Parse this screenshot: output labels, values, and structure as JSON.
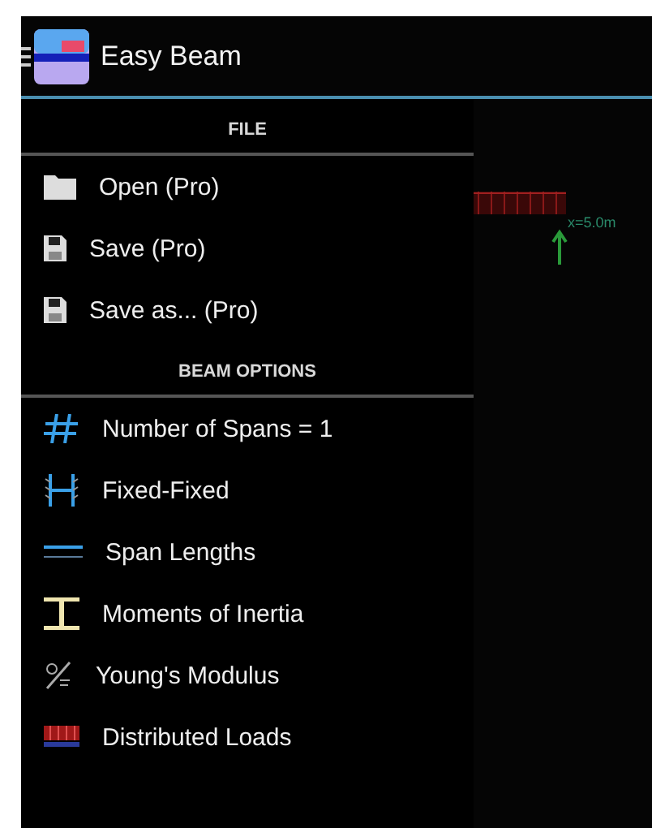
{
  "app_bar": {
    "title": "Easy Beam"
  },
  "canvas": {
    "position_label": "x=5.0m"
  },
  "sections": [
    {
      "header": "FILE",
      "items": [
        {
          "kind": "folder",
          "label": "Open (Pro)"
        },
        {
          "kind": "save",
          "label": "Save (Pro)"
        },
        {
          "kind": "save",
          "label": "Save as... (Pro)"
        }
      ]
    },
    {
      "header": "BEAM OPTIONS",
      "items": [
        {
          "kind": "hash",
          "label": "Number of Spans = 1"
        },
        {
          "kind": "fixed",
          "label": "Fixed-Fixed"
        },
        {
          "kind": "span",
          "label": "Span Lengths"
        },
        {
          "kind": "inertia",
          "label": "Moments of Inertia"
        },
        {
          "kind": "modulus",
          "label": "Young's Modulus"
        },
        {
          "kind": "loads",
          "label": "Distributed Loads"
        }
      ]
    }
  ]
}
